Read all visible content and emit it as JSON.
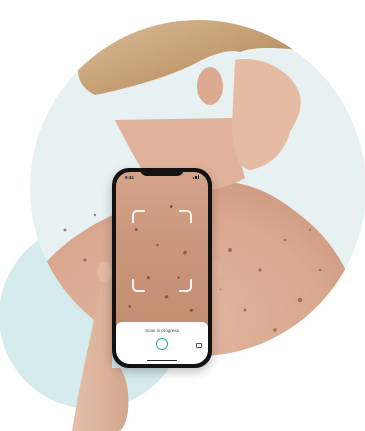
{
  "image": {
    "description_icon": "photo-illustration"
  },
  "phone": {
    "status_time": "9:41",
    "scan_label": "Scan in progress",
    "shutter_icon": "ring-button",
    "accent_color": "#2ea8a0"
  }
}
